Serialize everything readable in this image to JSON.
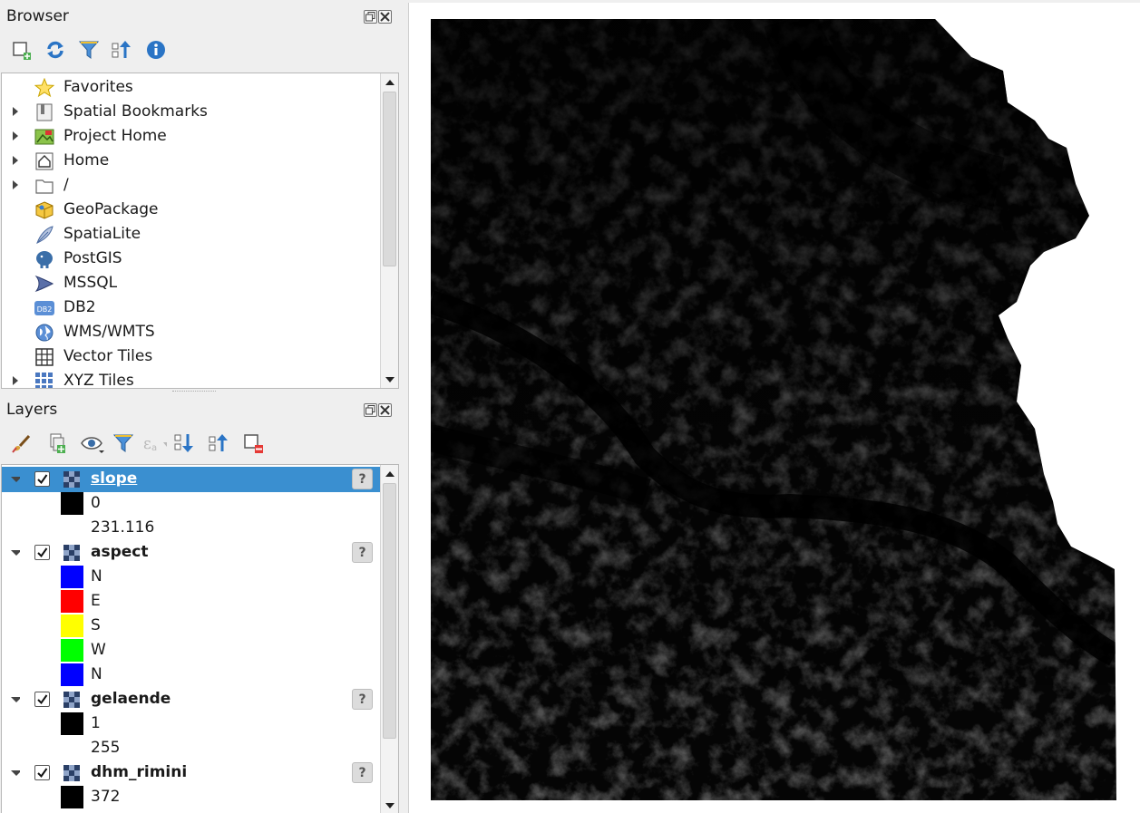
{
  "browser": {
    "title": "Browser",
    "items": [
      {
        "label": "Favorites",
        "icon": "star-icon",
        "expandable": false
      },
      {
        "label": "Spatial Bookmarks",
        "icon": "bookmark-icon",
        "expandable": true
      },
      {
        "label": "Project Home",
        "icon": "project-home-icon",
        "expandable": true
      },
      {
        "label": "Home",
        "icon": "home-icon",
        "expandable": true
      },
      {
        "label": "/",
        "icon": "folder-icon",
        "expandable": true
      },
      {
        "label": "GeoPackage",
        "icon": "geopackage-icon",
        "expandable": false
      },
      {
        "label": "SpatiaLite",
        "icon": "spatialite-feather-icon",
        "expandable": false
      },
      {
        "label": "PostGIS",
        "icon": "postgis-elephant-icon",
        "expandable": false
      },
      {
        "label": "MSSQL",
        "icon": "mssql-icon",
        "expandable": false
      },
      {
        "label": "DB2",
        "icon": "db2-icon",
        "expandable": false
      },
      {
        "label": "WMS/WMTS",
        "icon": "globe-icon",
        "expandable": false
      },
      {
        "label": "Vector Tiles",
        "icon": "grid-icon",
        "expandable": false
      },
      {
        "label": "XYZ Tiles",
        "icon": "xyz-tiles-icon",
        "expandable": true
      }
    ],
    "db2_badge": "DB2"
  },
  "layers": {
    "title": "Layers",
    "badge": "?",
    "items": [
      {
        "name": "slope",
        "selected": true,
        "legend": [
          {
            "color": "#000000",
            "label": "0"
          },
          {
            "color": null,
            "label": "231.116"
          }
        ]
      },
      {
        "name": "aspect",
        "selected": false,
        "legend": [
          {
            "color": "#0000ff",
            "label": "N"
          },
          {
            "color": "#ff0000",
            "label": "E"
          },
          {
            "color": "#ffff00",
            "label": "S"
          },
          {
            "color": "#00ff00",
            "label": "W"
          },
          {
            "color": "#0000ff",
            "label": "N"
          }
        ]
      },
      {
        "name": "gelaende",
        "selected": false,
        "legend": [
          {
            "color": "#000000",
            "label": "1"
          },
          {
            "color": null,
            "label": "255"
          }
        ]
      },
      {
        "name": "dhm_rimini",
        "selected": false,
        "legend": [
          {
            "color": "#000000",
            "label": "372"
          }
        ]
      }
    ]
  },
  "colors": {
    "selection": "#3a8fd0",
    "panel_bg": "#efefef"
  }
}
